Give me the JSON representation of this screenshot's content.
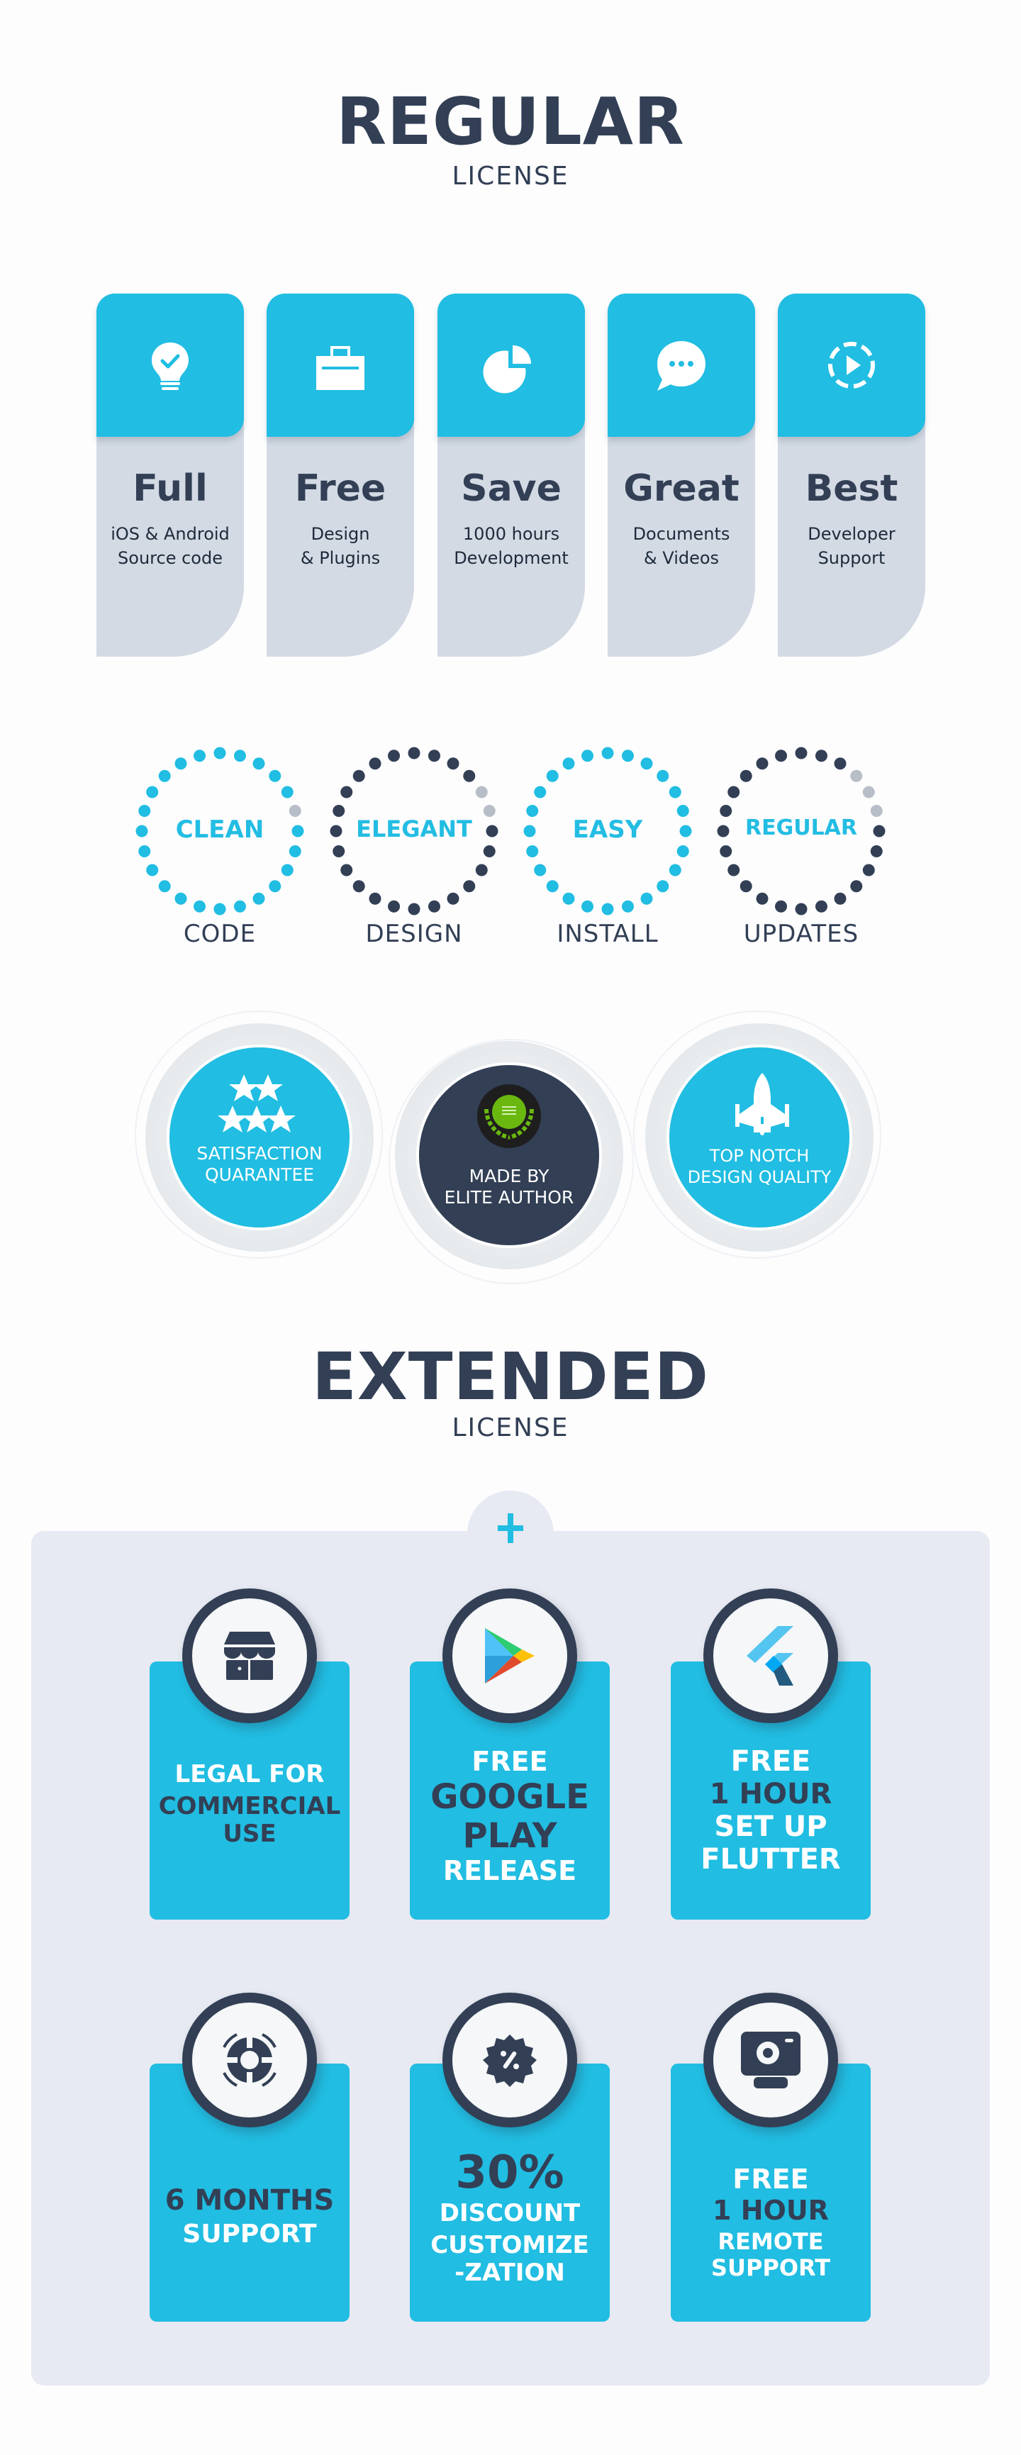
{
  "colors": {
    "accent": "#21bde2",
    "dark": "#323f55",
    "card_gray": "#d3dae4",
    "panel_bg": "#e7eaf2",
    "dot_inactive": "#b8bec7"
  },
  "regular": {
    "title": "REGULAR",
    "subtitle": "LICENSE",
    "cards": [
      {
        "icon": "lightbulb-check-icon",
        "heading": "Full",
        "line1": "iOS & Android",
        "line2": "Source code"
      },
      {
        "icon": "briefcase-icon",
        "heading": "Free",
        "line1": "Design",
        "line2": "& Plugins"
      },
      {
        "icon": "pie-chart-icon",
        "heading": "Save",
        "line1": "1000 hours",
        "line2": "Development"
      },
      {
        "icon": "chat-bubble-icon",
        "heading": "Great",
        "line1": "Documents",
        "line2": "& Videos"
      },
      {
        "icon": "play-circle-icon",
        "heading": "Best",
        "line1": "Developer",
        "line2": "Support"
      }
    ]
  },
  "rings": [
    {
      "word": "CLEAN",
      "label": "CODE",
      "style": "accent",
      "filled_fraction": 0.96
    },
    {
      "word": "ELEGANT",
      "label": "DESIGN",
      "style": "dark",
      "filled_fraction": 0.92
    },
    {
      "word": "EASY",
      "label": "INSTALL",
      "style": "accent",
      "filled_fraction": 1.0
    },
    {
      "word": "REGULAR",
      "label": "UPDATES",
      "style": "dark",
      "filled_fraction": 0.88
    }
  ],
  "badges": [
    {
      "icon": "five-stars-icon",
      "line1": "SATISFACTION",
      "line2": "QUARANTEE"
    },
    {
      "icon": "power-elite-laurel-icon",
      "line1": "MADE BY",
      "line2": "ELITE AUTHOR"
    },
    {
      "icon": "rocket-icon",
      "line1": "TOP NOTCH",
      "line2": "DESIGN QUALITY"
    }
  ],
  "extended": {
    "title": "EXTENDED",
    "subtitle": "LICENSE",
    "plus_icon": "plus-icon",
    "cards": [
      {
        "icon": "storefront-icon",
        "lines": [
          {
            "t": "LEGAL FOR",
            "c": "w"
          },
          {
            "t": "COMMERCIAL",
            "c": "d"
          },
          {
            "t": "USE",
            "c": "d"
          }
        ]
      },
      {
        "icon": "google-play-icon",
        "lines": [
          {
            "t": "FREE",
            "c": "w"
          },
          {
            "t": "GOOGLE",
            "c": "d"
          },
          {
            "t": "PLAY",
            "c": "d"
          },
          {
            "t": "RELEASE",
            "c": "w"
          }
        ]
      },
      {
        "icon": "flutter-logo-icon",
        "lines": [
          {
            "t": "FREE",
            "c": "w"
          },
          {
            "t": "1 HOUR",
            "c": "d"
          },
          {
            "t": "SET UP",
            "c": "w"
          },
          {
            "t": "FLUTTER",
            "c": "w"
          }
        ]
      },
      {
        "icon": "lifebuoy-icon",
        "lines": [
          {
            "t": "6 MONTHS",
            "c": "d"
          },
          {
            "t": "SUPPORT",
            "c": "w"
          }
        ]
      },
      {
        "icon": "discount-badge-icon",
        "lines": [
          {
            "t": "30%",
            "c": "d"
          },
          {
            "t": "DISCOUNT",
            "c": "w"
          },
          {
            "t": "CUSTOMIZE",
            "c": "w"
          },
          {
            "t": "-ZATION",
            "c": "w"
          }
        ]
      },
      {
        "icon": "webcam-icon",
        "lines": [
          {
            "t": "FREE",
            "c": "w"
          },
          {
            "t": "1 HOUR",
            "c": "d"
          },
          {
            "t": "REMOTE",
            "c": "w"
          },
          {
            "t": "SUPPORT",
            "c": "w"
          }
        ]
      }
    ]
  }
}
